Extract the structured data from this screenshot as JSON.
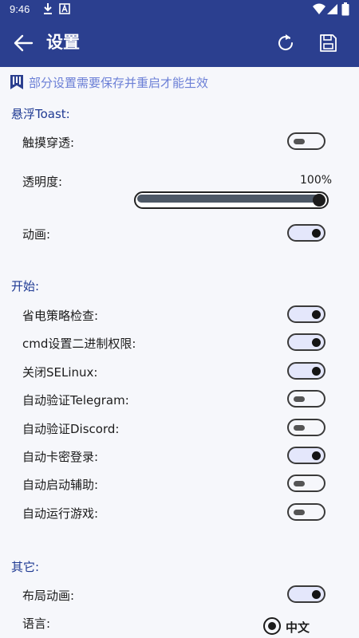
{
  "status_bar": {
    "time": "9:46"
  },
  "app_bar": {
    "title": "设置"
  },
  "notice": {
    "text": "部分设置需要保存并重启才能生效"
  },
  "sections": {
    "float_toast": "悬浮Toast:",
    "start": "开始:",
    "other": "其它:"
  },
  "float_toast": {
    "touch_through": {
      "label": "触摸穿透:",
      "enabled": false
    },
    "opacity": {
      "label": "透明度:",
      "value_text": "100%",
      "value": 100
    },
    "animation": {
      "label": "动画:",
      "enabled": true
    }
  },
  "start": {
    "items": [
      {
        "label": "省电策略检查:",
        "enabled": true
      },
      {
        "label": "cmd设置二进制权限:",
        "enabled": true
      },
      {
        "label": "关闭SELinux:",
        "enabled": true
      },
      {
        "label": "自动验证Telegram:",
        "enabled": false
      },
      {
        "label": "自动验证Discord:",
        "enabled": false
      },
      {
        "label": "自动卡密登录:",
        "enabled": true
      },
      {
        "label": "自动启动辅助:",
        "enabled": false
      },
      {
        "label": "自动运行游戏:",
        "enabled": false
      }
    ]
  },
  "other": {
    "layout_animation": {
      "label": "布局动画:",
      "enabled": true
    },
    "language": {
      "label": "语言:",
      "selected": "中文"
    }
  },
  "colors": {
    "primary": "#2b3f8f",
    "section_text": "#1f3a93",
    "notice_text": "#6b7fd6",
    "toggle_on_bg": "#e4e7fb"
  }
}
